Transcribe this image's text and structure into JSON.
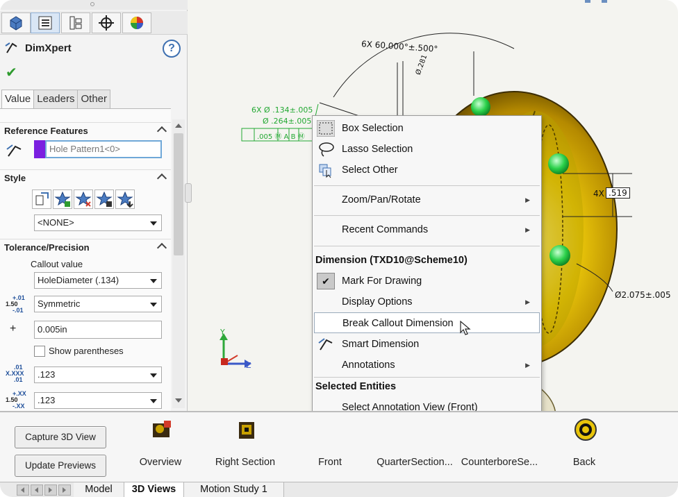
{
  "property_manager": {
    "title": "DimXpert",
    "help": "?",
    "ok": "✔",
    "subtabs": [
      "Value",
      "Leaders",
      "Other"
    ],
    "reference_features": {
      "heading": "Reference Features",
      "value": "Hole Pattern1<0>",
      "swatch_color": "#7b1fe0"
    },
    "style": {
      "heading": "Style",
      "selected": "<NONE>"
    },
    "tolerance": {
      "heading": "Tolerance/Precision",
      "callout_label": "Callout value",
      "callout_value": "HoleDiameter (.134)",
      "tol_icon_top": "+.01",
      "tol_icon_mid": "1.50",
      "tol_icon_bot": "-.01",
      "tolerance_type": "Symmetric",
      "plus_sign": "+",
      "tolerance_value": "0.005in",
      "show_parentheses": "Show parentheses",
      "prec_icon_top": ".01",
      "prec_icon_mid": "X.XXX",
      "prec_icon_bot": ".01",
      "precision_primary": ".123",
      "prec2_icon_top": "+.XX",
      "prec2_icon_mid": "1.50",
      "prec2_icon_bot": "-.XX",
      "precision_tolerance": ".123"
    }
  },
  "viewport": {
    "dim_angle": "6X 60.000°±.500°",
    "dim_small": "Ø.281",
    "callout_line1": "6X  Ø  .134±.005",
    "callout_line2": "Ø  .264±.005",
    "callout_line3": ".005  Ⓜ  A  B  Ⓜ",
    "dim_4x": "4X",
    "dim_519": ".519",
    "dim_dia": "Ø2.075±.005",
    "axis_y": "Y",
    "axis_z": "Z"
  },
  "context_menu": {
    "items": [
      {
        "label": "Box Selection",
        "icon": "box-selection-icon"
      },
      {
        "label": "Lasso Selection",
        "icon": "lasso-icon"
      },
      {
        "label": "Select Other",
        "icon": "select-other-icon"
      },
      {
        "label": "Zoom/Pan/Rotate",
        "submenu": "▶"
      },
      {
        "label": "Recent Commands",
        "submenu": "▶"
      }
    ],
    "section_dimension": "Dimension (TXD10@Scheme10)",
    "dim_items": [
      {
        "label": "Mark For Drawing",
        "checked": "✔"
      },
      {
        "label": "Display Options",
        "submenu": "▶"
      },
      {
        "label": "Break Callout Dimension"
      },
      {
        "label": "Smart Dimension",
        "icon": "smart-dimension-icon"
      },
      {
        "label": "Annotations",
        "submenu": "▶"
      }
    ],
    "section_entities": "Selected Entities",
    "entity_items": [
      {
        "label": "Select Annotation View (Front)"
      }
    ],
    "expand": "»"
  },
  "views_bar": {
    "capture_button": "Capture 3D View",
    "update_button": "Update Previews",
    "views": [
      "Overview",
      "Right Section",
      "Front",
      "QuarterSection...",
      "CounterboreSe...",
      "Back"
    ]
  },
  "bottom_tabs": [
    "Model",
    "3D Views",
    "Motion Study 1"
  ],
  "colors": {
    "accent_blue": "#3d6fb0",
    "callout_green": "#22a832",
    "part_gold": "#d9b400",
    "hole_green": "#2bd14a"
  }
}
